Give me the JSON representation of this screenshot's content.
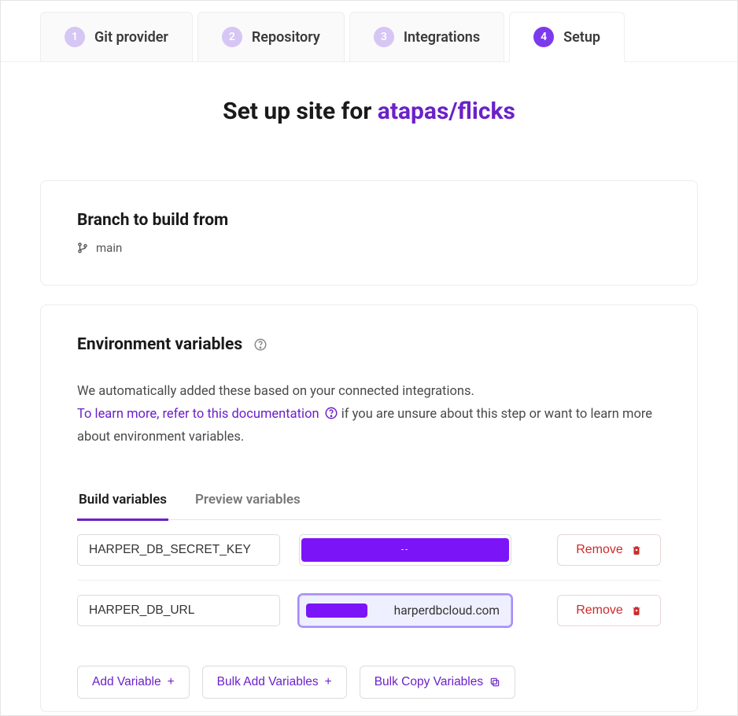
{
  "stepper": {
    "steps": [
      {
        "num": "1",
        "label": "Git provider"
      },
      {
        "num": "2",
        "label": "Repository"
      },
      {
        "num": "3",
        "label": "Integrations"
      },
      {
        "num": "4",
        "label": "Setup"
      }
    ]
  },
  "heading": {
    "prefix": "Set up site for ",
    "repo": "atapas/flicks"
  },
  "branch_card": {
    "title": "Branch to build from",
    "value": "main"
  },
  "env_card": {
    "title": "Environment variables",
    "intro": "We automatically added these based on your connected integrations.",
    "link_text": "To learn more, refer to this documentation",
    "outro": " if you are unsure about this step or want to learn more about environment variables.",
    "tabs": {
      "build": "Build variables",
      "preview": "Preview variables"
    },
    "vars": [
      {
        "key": "HARPER_DB_SECRET_KEY",
        "value": ""
      },
      {
        "key": "HARPER_DB_URL",
        "value": "harperdbcloud.com"
      }
    ],
    "remove_label": "Remove",
    "actions": {
      "add": "Add Variable",
      "bulk_add": "Bulk Add Variables",
      "bulk_copy": "Bulk Copy Variables"
    }
  }
}
